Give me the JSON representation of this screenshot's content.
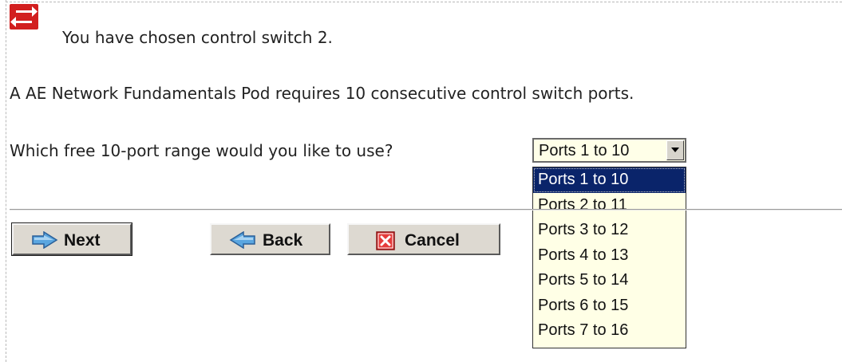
{
  "intro": {
    "chosen_text": "You have chosen control switch 2.",
    "requirement_text": "A AE Network Fundamentals Pod requires 10 consecutive control switch ports.",
    "question_text": "Which free 10-port range would you like to use?"
  },
  "port_select": {
    "selected_value": "Ports 1 to 10",
    "options": [
      "Ports 1 to 10",
      "Ports 2 to 11",
      "Ports 3 to 12",
      "Ports 4 to 13",
      "Ports 5 to 14",
      "Ports 6 to 15",
      "Ports 7 to 16"
    ],
    "highlighted_index": 0
  },
  "buttons": {
    "next_label": "Next",
    "back_label": "Back",
    "cancel_label": "Cancel"
  },
  "icons": {
    "header": "control-switch-icon",
    "next": "arrow-right-icon",
    "back": "arrow-left-icon",
    "cancel": "cancel-x-icon",
    "dropdown": "chevron-down-icon"
  },
  "colors": {
    "switch_icon_red": "#d21f1f",
    "select_background": "#ffffe6",
    "highlight": "#0a246a",
    "button_face": "#ddd9d1",
    "arrow_blue": "#5aa6e0",
    "cancel_red": "#e53b3b"
  }
}
